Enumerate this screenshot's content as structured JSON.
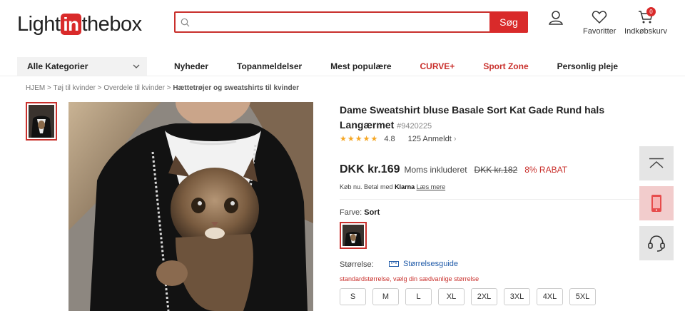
{
  "header": {
    "logo": {
      "part1": "Light",
      "part2": "in",
      "part3": "thebox"
    },
    "search": {
      "placeholder": "",
      "button": "Søg"
    },
    "favorites": "Favoritter",
    "cart": "Indkøbskurv",
    "cart_count": "0"
  },
  "nav": {
    "category_select": "Alle Kategorier",
    "items": [
      "Nyheder",
      "Topanmeldelser",
      "Mest populære",
      "CURVE+",
      "Sport Zone",
      "Personlig pleje"
    ]
  },
  "breadcrumb": {
    "items": [
      "HJEM",
      "Tøj til kvinder",
      "Overdele til kvinder"
    ],
    "current": "Hættetrøjer og sweatshirts til kvinder"
  },
  "product": {
    "title": "Dame Sweatshirt bluse Basale Sort Kat Gade Rund hals Langærmet",
    "sku": "#9420225",
    "stars": "★★★★★",
    "rating": "4.8",
    "reviews": "125 Anmeldt",
    "price": "DKK kr.169",
    "tax_note": "Moms inkluderet",
    "old_price": "DKK kr.182",
    "discount": "8% RABAT",
    "klarna": {
      "prefix": "Køb nu. Betal med",
      "brand": "Klarna",
      "link": "Læs mere"
    },
    "color_label": "Farve:",
    "color_value": "Sort",
    "size_label": "Størrelse:",
    "size_guide": "Størrelsesguide",
    "size_hint": "standardstørrelse, vælg din sædvanlige størrelse",
    "sizes": [
      "S",
      "M",
      "L",
      "XL",
      "2XL",
      "3XL",
      "4XL",
      "5XL"
    ]
  },
  "colors": {
    "accent": "#d92a2a",
    "link": "#1f5aa8",
    "star": "#f5a623"
  }
}
